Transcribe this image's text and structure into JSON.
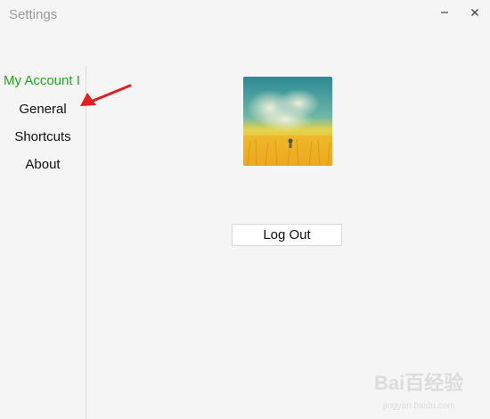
{
  "window": {
    "title": "Settings",
    "minimize_label": "—",
    "close_label": "✕"
  },
  "sidebar": {
    "items": [
      {
        "label": "My Account I",
        "active": true
      },
      {
        "label": "General",
        "active": false
      },
      {
        "label": "Shortcuts",
        "active": false
      },
      {
        "label": "About",
        "active": false
      }
    ]
  },
  "main": {
    "logout_label": "Log Out"
  },
  "watermark": {
    "brand": "Bai百经验",
    "url": "jingyan.baidu.com"
  },
  "colors": {
    "accent": "#1aad19",
    "annotation_arrow": "#e02020"
  }
}
